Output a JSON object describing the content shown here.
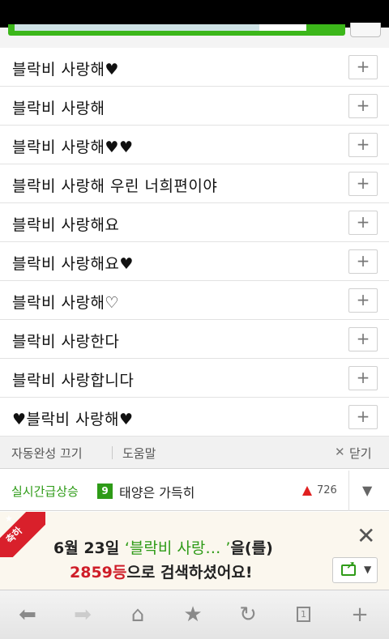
{
  "suggestions": [
    {
      "text": "블락비 사랑해♥"
    },
    {
      "text": "블락비 사랑해"
    },
    {
      "text": "블락비 사랑해♥♥"
    },
    {
      "text": "블락비 사랑해 우린 너희편이야"
    },
    {
      "text": "블락비 사랑해요"
    },
    {
      "text": "블락비 사랑해요♥"
    },
    {
      "text": "블락비 사랑해♡"
    },
    {
      "text": "블락비 사랑한다"
    },
    {
      "text": "블락비 사랑합니다"
    },
    {
      "text": "♥블락비 사랑해♥"
    }
  ],
  "plus_label": "+",
  "footer": {
    "autocomplete_off": "자동완성 끄기",
    "help": "도움말",
    "close_icon": "✕",
    "close": "닫기"
  },
  "trending": {
    "label": "실시간급상승",
    "rank": "9",
    "keyword": "태양은 가득히",
    "count": "726",
    "expand_icon": "chevron-down-icon"
  },
  "banner": {
    "ribbon_label": "축하",
    "date": "6월 23일",
    "keyword": "‘블락비 사랑… ’",
    "suffix": "을(를)",
    "rank": "2859등",
    "line2_rest": "으로 검색하셨어요!",
    "close_icon": "close-icon",
    "share_icon": "share-icon"
  },
  "toolbar": {
    "tab_count": "1"
  },
  "colors": {
    "accent_green": "#2e9b17",
    "search_green": "#3cb71a",
    "rank_red": "#cf1d28"
  }
}
